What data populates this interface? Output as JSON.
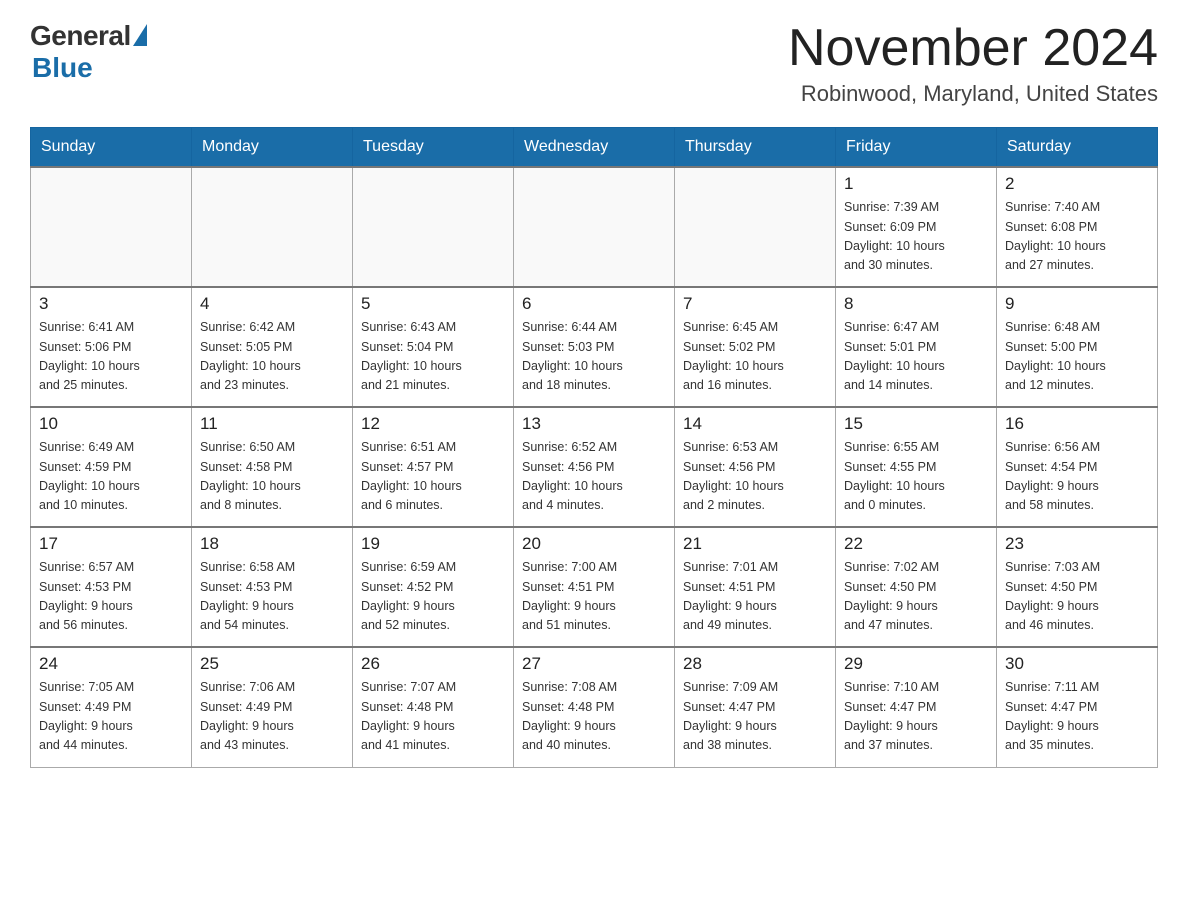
{
  "logo": {
    "general": "General",
    "blue": "Blue"
  },
  "title": "November 2024",
  "location": "Robinwood, Maryland, United States",
  "days_of_week": [
    "Sunday",
    "Monday",
    "Tuesday",
    "Wednesday",
    "Thursday",
    "Friday",
    "Saturday"
  ],
  "weeks": [
    [
      {
        "day": "",
        "info": ""
      },
      {
        "day": "",
        "info": ""
      },
      {
        "day": "",
        "info": ""
      },
      {
        "day": "",
        "info": ""
      },
      {
        "day": "",
        "info": ""
      },
      {
        "day": "1",
        "info": "Sunrise: 7:39 AM\nSunset: 6:09 PM\nDaylight: 10 hours\nand 30 minutes."
      },
      {
        "day": "2",
        "info": "Sunrise: 7:40 AM\nSunset: 6:08 PM\nDaylight: 10 hours\nand 27 minutes."
      }
    ],
    [
      {
        "day": "3",
        "info": "Sunrise: 6:41 AM\nSunset: 5:06 PM\nDaylight: 10 hours\nand 25 minutes."
      },
      {
        "day": "4",
        "info": "Sunrise: 6:42 AM\nSunset: 5:05 PM\nDaylight: 10 hours\nand 23 minutes."
      },
      {
        "day": "5",
        "info": "Sunrise: 6:43 AM\nSunset: 5:04 PM\nDaylight: 10 hours\nand 21 minutes."
      },
      {
        "day": "6",
        "info": "Sunrise: 6:44 AM\nSunset: 5:03 PM\nDaylight: 10 hours\nand 18 minutes."
      },
      {
        "day": "7",
        "info": "Sunrise: 6:45 AM\nSunset: 5:02 PM\nDaylight: 10 hours\nand 16 minutes."
      },
      {
        "day": "8",
        "info": "Sunrise: 6:47 AM\nSunset: 5:01 PM\nDaylight: 10 hours\nand 14 minutes."
      },
      {
        "day": "9",
        "info": "Sunrise: 6:48 AM\nSunset: 5:00 PM\nDaylight: 10 hours\nand 12 minutes."
      }
    ],
    [
      {
        "day": "10",
        "info": "Sunrise: 6:49 AM\nSunset: 4:59 PM\nDaylight: 10 hours\nand 10 minutes."
      },
      {
        "day": "11",
        "info": "Sunrise: 6:50 AM\nSunset: 4:58 PM\nDaylight: 10 hours\nand 8 minutes."
      },
      {
        "day": "12",
        "info": "Sunrise: 6:51 AM\nSunset: 4:57 PM\nDaylight: 10 hours\nand 6 minutes."
      },
      {
        "day": "13",
        "info": "Sunrise: 6:52 AM\nSunset: 4:56 PM\nDaylight: 10 hours\nand 4 minutes."
      },
      {
        "day": "14",
        "info": "Sunrise: 6:53 AM\nSunset: 4:56 PM\nDaylight: 10 hours\nand 2 minutes."
      },
      {
        "day": "15",
        "info": "Sunrise: 6:55 AM\nSunset: 4:55 PM\nDaylight: 10 hours\nand 0 minutes."
      },
      {
        "day": "16",
        "info": "Sunrise: 6:56 AM\nSunset: 4:54 PM\nDaylight: 9 hours\nand 58 minutes."
      }
    ],
    [
      {
        "day": "17",
        "info": "Sunrise: 6:57 AM\nSunset: 4:53 PM\nDaylight: 9 hours\nand 56 minutes."
      },
      {
        "day": "18",
        "info": "Sunrise: 6:58 AM\nSunset: 4:53 PM\nDaylight: 9 hours\nand 54 minutes."
      },
      {
        "day": "19",
        "info": "Sunrise: 6:59 AM\nSunset: 4:52 PM\nDaylight: 9 hours\nand 52 minutes."
      },
      {
        "day": "20",
        "info": "Sunrise: 7:00 AM\nSunset: 4:51 PM\nDaylight: 9 hours\nand 51 minutes."
      },
      {
        "day": "21",
        "info": "Sunrise: 7:01 AM\nSunset: 4:51 PM\nDaylight: 9 hours\nand 49 minutes."
      },
      {
        "day": "22",
        "info": "Sunrise: 7:02 AM\nSunset: 4:50 PM\nDaylight: 9 hours\nand 47 minutes."
      },
      {
        "day": "23",
        "info": "Sunrise: 7:03 AM\nSunset: 4:50 PM\nDaylight: 9 hours\nand 46 minutes."
      }
    ],
    [
      {
        "day": "24",
        "info": "Sunrise: 7:05 AM\nSunset: 4:49 PM\nDaylight: 9 hours\nand 44 minutes."
      },
      {
        "day": "25",
        "info": "Sunrise: 7:06 AM\nSunset: 4:49 PM\nDaylight: 9 hours\nand 43 minutes."
      },
      {
        "day": "26",
        "info": "Sunrise: 7:07 AM\nSunset: 4:48 PM\nDaylight: 9 hours\nand 41 minutes."
      },
      {
        "day": "27",
        "info": "Sunrise: 7:08 AM\nSunset: 4:48 PM\nDaylight: 9 hours\nand 40 minutes."
      },
      {
        "day": "28",
        "info": "Sunrise: 7:09 AM\nSunset: 4:47 PM\nDaylight: 9 hours\nand 38 minutes."
      },
      {
        "day": "29",
        "info": "Sunrise: 7:10 AM\nSunset: 4:47 PM\nDaylight: 9 hours\nand 37 minutes."
      },
      {
        "day": "30",
        "info": "Sunrise: 7:11 AM\nSunset: 4:47 PM\nDaylight: 9 hours\nand 35 minutes."
      }
    ]
  ]
}
